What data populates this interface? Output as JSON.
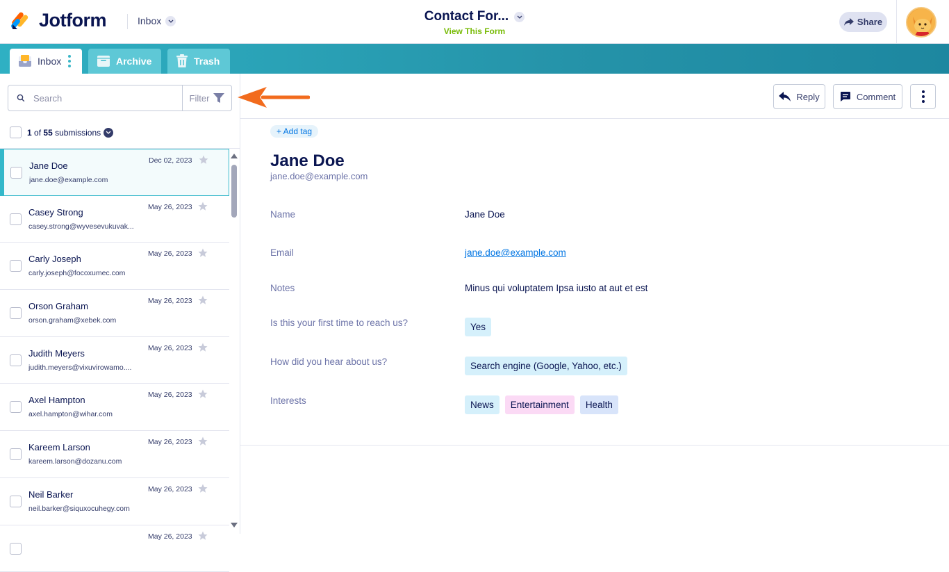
{
  "brand": {
    "name": "Jotform"
  },
  "header": {
    "folder_label": "Inbox",
    "form_title": "Contact For...",
    "view_form_link": "View This Form",
    "share_label": "Share"
  },
  "tabs": [
    {
      "label": "Inbox"
    },
    {
      "label": "Archive"
    },
    {
      "label": "Trash"
    }
  ],
  "sidebar": {
    "search_placeholder": "Search",
    "filter_label": "Filter",
    "count_current": "1",
    "count_of": "of",
    "count_total": "55",
    "count_suffix": "submissions",
    "submissions": [
      {
        "name": "Jane Doe",
        "email": "jane.doe@example.com",
        "date": "Dec 02, 2023"
      },
      {
        "name": "Casey Strong",
        "email": "casey.strong@wyvesevukuvak...",
        "date": "May 26, 2023"
      },
      {
        "name": "Carly Joseph",
        "email": "carly.joseph@focoxumec.com",
        "date": "May 26, 2023"
      },
      {
        "name": "Orson Graham",
        "email": "orson.graham@xebek.com",
        "date": "May 26, 2023"
      },
      {
        "name": "Judith Meyers",
        "email": "judith.meyers@vixuvirowamo....",
        "date": "May 26, 2023"
      },
      {
        "name": "Axel Hampton",
        "email": "axel.hampton@wihar.com",
        "date": "May 26, 2023"
      },
      {
        "name": "Kareem Larson",
        "email": "kareem.larson@dozanu.com",
        "date": "May 26, 2023"
      },
      {
        "name": "Neil Barker",
        "email": "neil.barker@siquxocuhegy.com",
        "date": "May 26, 2023"
      },
      {
        "name": "",
        "email": "",
        "date": "May 26, 2023"
      }
    ]
  },
  "actions": {
    "reply_label": "Reply",
    "comment_label": "Comment"
  },
  "submission": {
    "add_tag_label": "+ Add tag",
    "name": "Jane Doe",
    "email": "jane.doe@example.com",
    "fields": {
      "name_label": "Name",
      "name_value": "Jane Doe",
      "email_label": "Email",
      "email_value": "jane.doe@example.com",
      "notes_label": "Notes",
      "notes_value": "Minus qui voluptatem Ipsa iusto at aut et est",
      "first_time_label": "Is this your first time to reach us?",
      "first_time_value": "Yes",
      "hear_label": "How did you hear about us?",
      "hear_value": "Search engine (Google, Yahoo, etc.)",
      "interests_label": "Interests",
      "interests": [
        "News",
        "Entertainment",
        "Health"
      ]
    }
  },
  "colors": {
    "accent": "#34b8ca",
    "arrow": "#f26b1d",
    "brand_text": "#0a1551",
    "link": "#0075e3"
  }
}
